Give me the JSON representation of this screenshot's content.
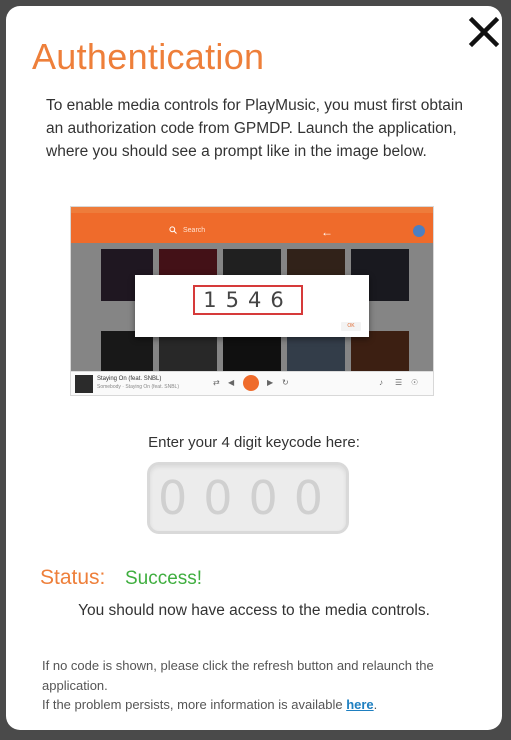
{
  "dialog": {
    "title": "Authentication",
    "intro": "To enable media controls for PlayMusic, you must first obtain an authorization code from GPMDP. Launch the application, where you should see a prompt like in the image below.",
    "close_icon": "close-icon"
  },
  "example_screenshot": {
    "search_placeholder": "Search",
    "popup_code": "1546",
    "popup_ok": "OK",
    "player_title": "Staying On (feat. SNBL)",
    "player_subtitle": "Somebody · Staying On (feat. SNBL)",
    "colors": {
      "accent": "#ef6b2b",
      "popup_border": "#d63a3a"
    }
  },
  "keycode": {
    "label": "Enter your 4 digit keycode here:",
    "value": "0000"
  },
  "status": {
    "label": "Status:",
    "value": "Success!",
    "message": "You should now have access to the media controls."
  },
  "help": {
    "line1": "If no code is shown, please click the refresh button and relaunch the application.",
    "line2_prefix": "If the problem persists, more information is available ",
    "link_text": "here",
    "line2_suffix": "."
  },
  "colors": {
    "title": "#ee7f3a",
    "success": "#3fae3f",
    "link": "#1e7fc0",
    "backdrop": "#4a4a4a"
  }
}
